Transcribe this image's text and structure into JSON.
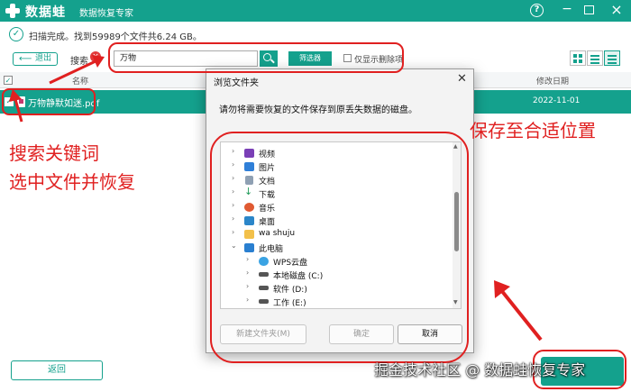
{
  "app": {
    "name": "数据蛙",
    "subtitle": "数据恢复专家"
  },
  "status": {
    "text": "扫描完成。找到59989个文件共6.24 GB。"
  },
  "toolbar": {
    "exit_label": "退出",
    "search_label": "搜索",
    "search_value": "万物",
    "filter_label": "筛选器",
    "show_deleted_label": "仅显示删除项"
  },
  "table": {
    "col_name": "名称",
    "col_modified": "修改日期",
    "rows": [
      {
        "name": "万物静默如迷.pdf",
        "modified": "2022-11-01"
      }
    ]
  },
  "footer": {
    "back_label": "返回"
  },
  "dialog": {
    "title": "浏览文件夹",
    "prompt": "请勿将需要恢复的文件保存到原丢失数据的磁盘。",
    "tree": [
      {
        "label": "视频",
        "icon": "video-icon"
      },
      {
        "label": "图片",
        "icon": "pictures-icon"
      },
      {
        "label": "文档",
        "icon": "documents-icon"
      },
      {
        "label": "下载",
        "icon": "downloads-icon"
      },
      {
        "label": "音乐",
        "icon": "music-icon"
      },
      {
        "label": "桌面",
        "icon": "desktop-icon"
      },
      {
        "label": "wa shuju",
        "icon": "folder-icon"
      },
      {
        "label": "此电脑",
        "icon": "this-pc-icon"
      },
      {
        "label": "WPS云盘",
        "icon": "cloud-icon"
      },
      {
        "label": "本地磁盘 (C:)",
        "icon": "drive-icon"
      },
      {
        "label": "软件 (D:)",
        "icon": "drive-icon"
      },
      {
        "label": "工作 (E:)",
        "icon": "drive-icon"
      }
    ],
    "new_folder_label": "新建文件夹(M)",
    "ok_label": "确定",
    "cancel_label": "取消"
  },
  "annotations": {
    "search_note": "搜索关键词",
    "recover_note": "选中文件并恢复",
    "save_note": "保存至合适位置"
  },
  "watermark": "掘金技术社区 @ 数据蛙恢复专家",
  "colors": {
    "accent": "#14a18d",
    "annotation": "#e02020"
  }
}
